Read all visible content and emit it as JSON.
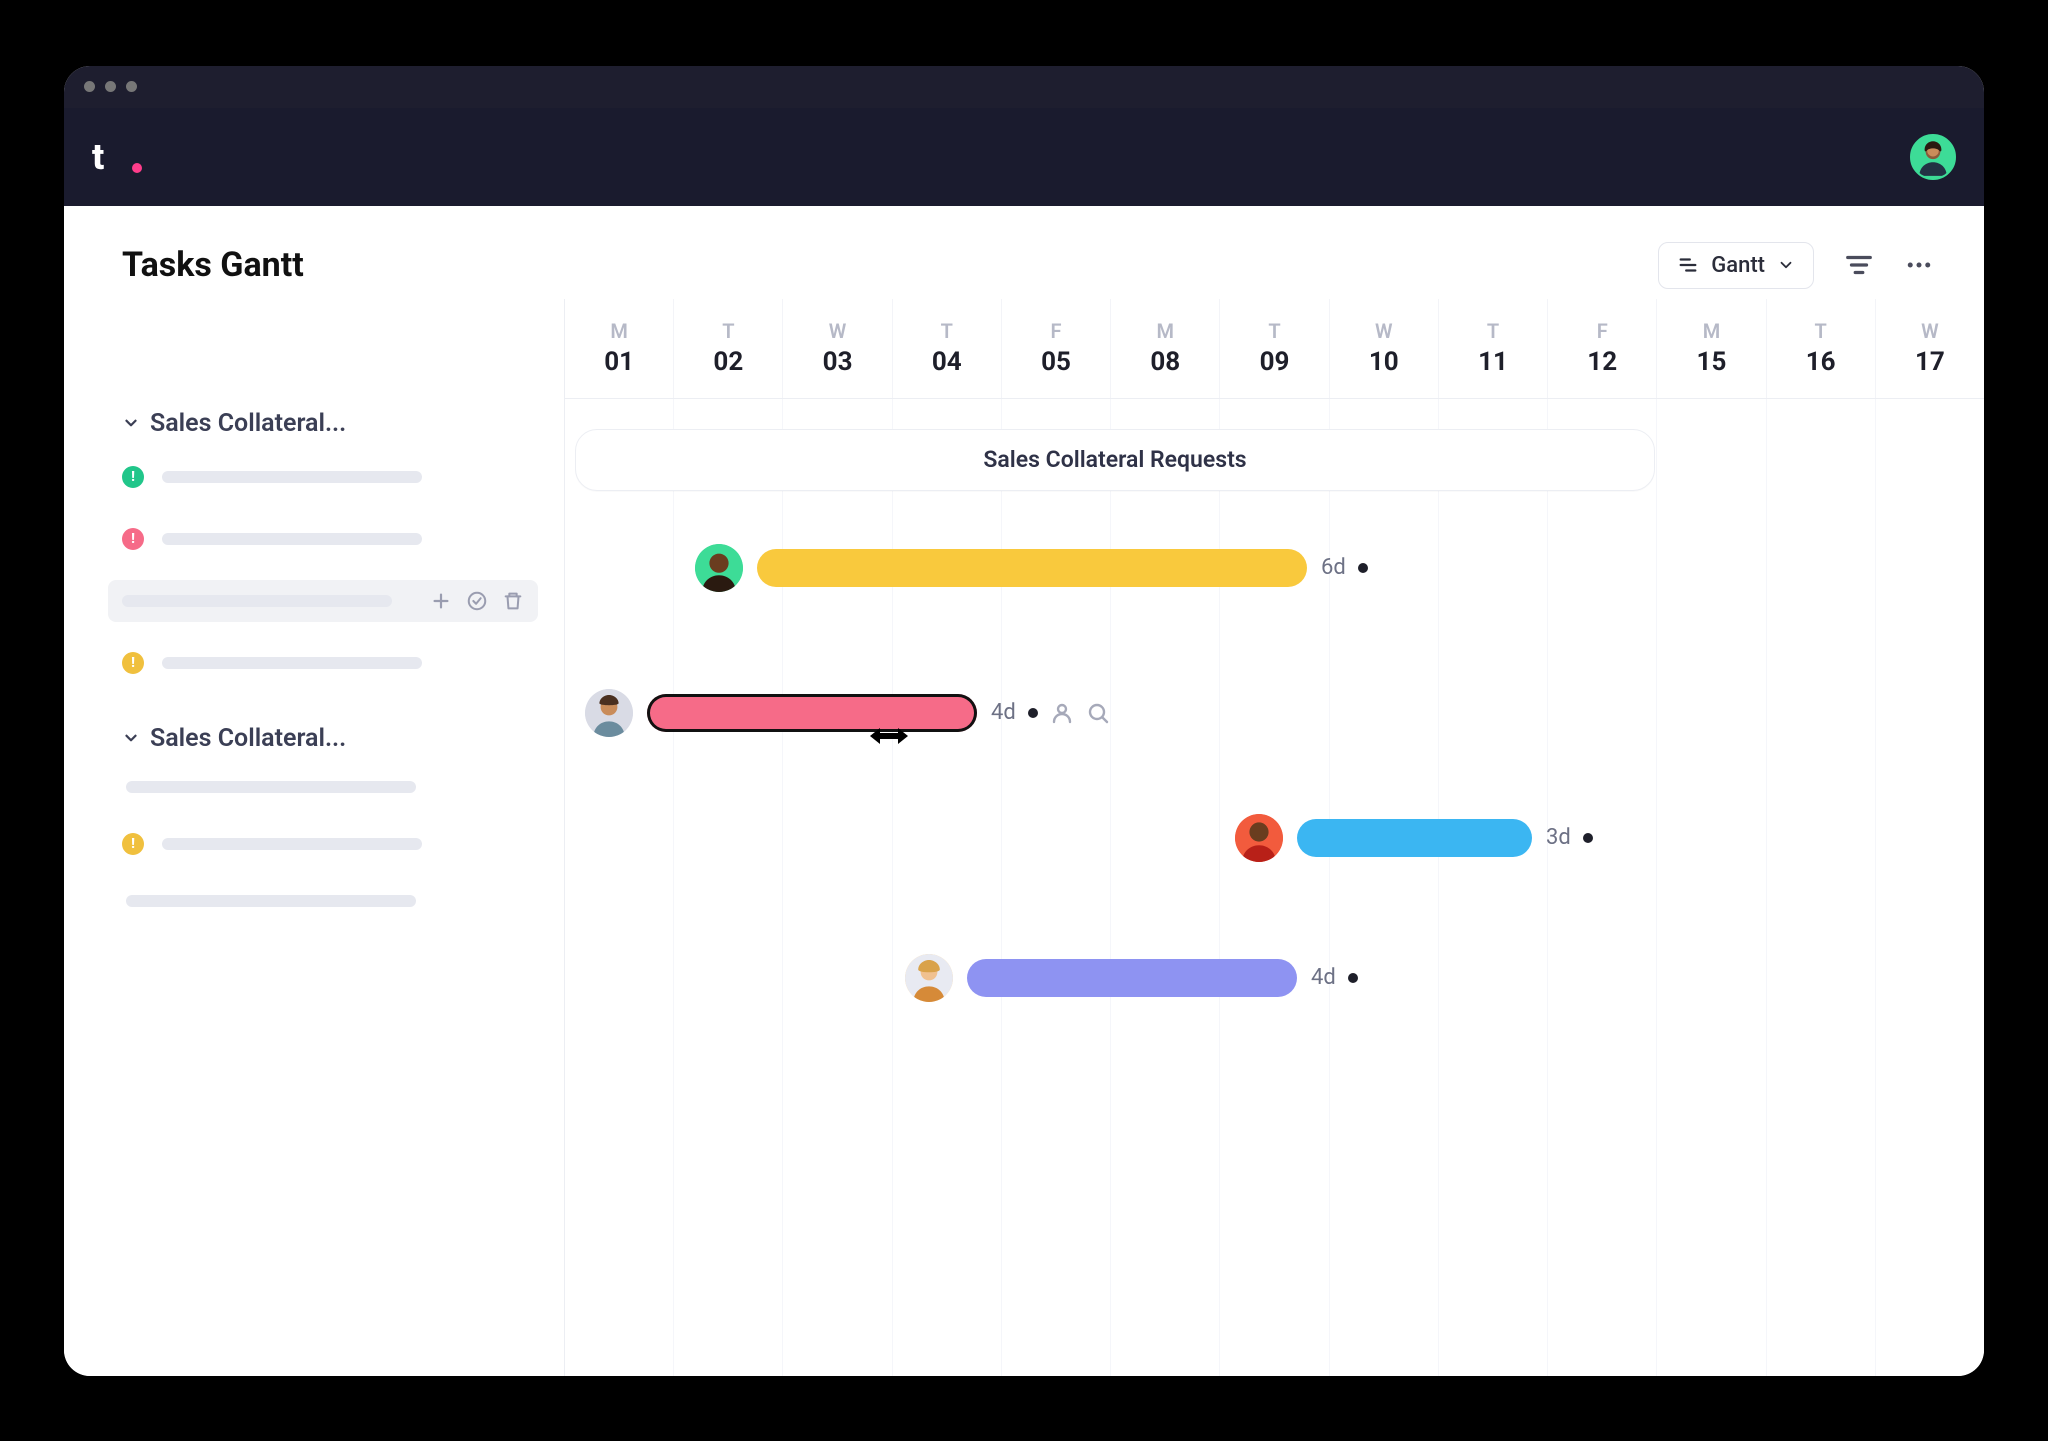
{
  "header": {
    "page_title": "Tasks Gantt"
  },
  "view_selector": {
    "label": "Gantt"
  },
  "timeline": {
    "columns": [
      {
        "day": "M",
        "date": "01"
      },
      {
        "day": "T",
        "date": "02"
      },
      {
        "day": "W",
        "date": "03"
      },
      {
        "day": "T",
        "date": "04"
      },
      {
        "day": "F",
        "date": "05"
      },
      {
        "day": "M",
        "date": "08"
      },
      {
        "day": "T",
        "date": "09"
      },
      {
        "day": "W",
        "date": "10"
      },
      {
        "day": "T",
        "date": "11"
      },
      {
        "day": "F",
        "date": "12"
      },
      {
        "day": "M",
        "date": "15"
      },
      {
        "day": "T",
        "date": "16"
      },
      {
        "day": "W",
        "date": "17"
      }
    ]
  },
  "sidebar": {
    "groups": [
      {
        "name": "Sales Collateral..."
      },
      {
        "name": "Sales Collateral..."
      }
    ]
  },
  "group_pill": {
    "label": "Sales Collateral Requests"
  },
  "tasks": [
    {
      "duration": "6d",
      "color": "#f9c93d",
      "assignee_bg": "#3ddc97"
    },
    {
      "duration": "4d",
      "color": "#f66b88",
      "assignee_bg": "#d9dbe5",
      "selected": true
    },
    {
      "duration": "3d",
      "color": "#3bb6f2",
      "assignee_bg": "#f25b3d"
    },
    {
      "duration": "4d",
      "color": "#8e93f2",
      "assignee_bg": "#ffd89a"
    }
  ],
  "colors": {
    "status_green": "#21c68a",
    "status_pink": "#f66b88",
    "status_yellow": "#f0c03e"
  }
}
